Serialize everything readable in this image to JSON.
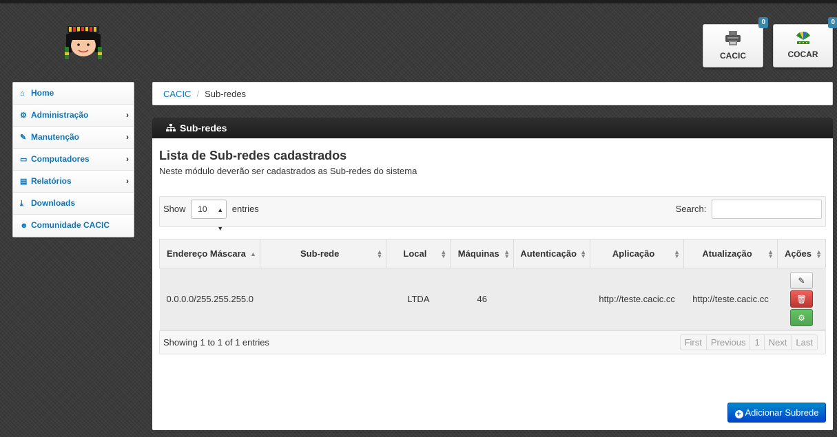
{
  "tiles": [
    {
      "label": "CACIC",
      "badge": "0",
      "icon": "printer-icon"
    },
    {
      "label": "COCAR",
      "badge": "0",
      "icon": "cocar-logo-icon"
    }
  ],
  "sidebar": {
    "items": [
      {
        "label": "Home",
        "icon": "home-icon",
        "has_submenu": false
      },
      {
        "label": "Administração",
        "icon": "gears-icon",
        "has_submenu": true
      },
      {
        "label": "Manutenção",
        "icon": "wrench-icon",
        "has_submenu": true
      },
      {
        "label": "Computadores",
        "icon": "desktop-icon",
        "has_submenu": true
      },
      {
        "label": "Relatórios",
        "icon": "book-icon",
        "has_submenu": true
      },
      {
        "label": "Downloads",
        "icon": "download-icon",
        "has_submenu": false
      },
      {
        "label": "Comunidade CACIC",
        "icon": "users-icon",
        "has_submenu": false
      }
    ]
  },
  "breadcrumb": {
    "link": "CACIC",
    "separator": "/",
    "current": "Sub-redes"
  },
  "panel": {
    "header": "Sub-redes",
    "title": "Lista de Sub-redes cadastrados",
    "description": "Neste módulo deverão ser cadastrados as Sub-redes do sistema"
  },
  "datatable": {
    "length_label_before": "Show",
    "length_value": "10",
    "length_label_after": "entries",
    "search_label": "Search:",
    "search_value": "",
    "columns": [
      "Endereço Máscara",
      "Sub-rede",
      "Local",
      "Máquinas",
      "Autenticação",
      "Aplicação",
      "Atualização",
      "Ações"
    ],
    "rows": [
      {
        "endereco_mascara": "0.0.0.0/255.255.255.0",
        "sub_rede": "",
        "local": "LTDA",
        "maquinas": "46",
        "autenticacao": "",
        "aplicacao": "http://teste.cacic.cc",
        "atualizacao": "http://teste.cacic.cc"
      }
    ],
    "info": "Showing 1 to 1 of 1 entries",
    "pagination": [
      "First",
      "Previous",
      "1",
      "Next",
      "Last"
    ]
  },
  "add_button": "Adicionar Subrede",
  "colors": {
    "link": "#0f75b6",
    "badge": "#3a87ad",
    "primary": "#0055cc",
    "danger": "#d9534f",
    "success": "#5cb85c"
  }
}
